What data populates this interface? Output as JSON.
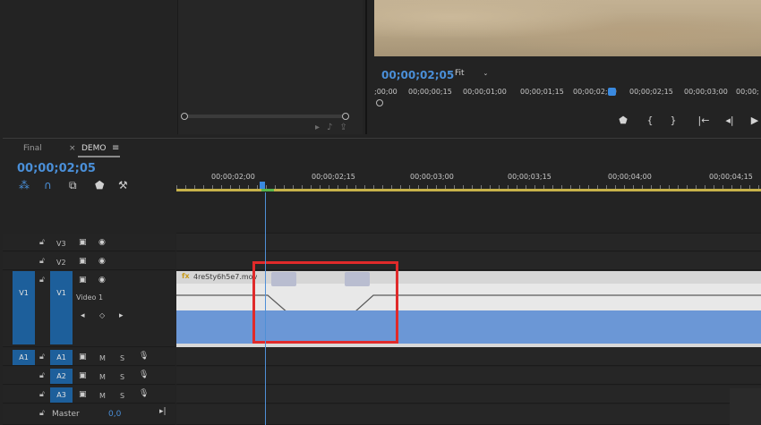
{
  "program_monitor": {
    "timecode": "00;00;02;05",
    "fit_label": "Fit",
    "ruler_ticks": [
      ";00;00",
      "00;00;00;15",
      "00;00;01;00",
      "00;00;01;15",
      "00;00;02;00",
      "00;00;02;15",
      "00;00;03;00",
      "00;00;"
    ],
    "buttons": [
      {
        "name": "add-marker-button",
        "icon": "marker-icon",
        "glyph": "⬟"
      },
      {
        "name": "mark-in-button",
        "icon": "mark-in-icon",
        "glyph": "{"
      },
      {
        "name": "mark-out-button",
        "icon": "mark-out-icon",
        "glyph": "}"
      },
      {
        "name": "go-to-in-button",
        "icon": "go-to-in-icon",
        "glyph": "|←"
      },
      {
        "name": "step-back-button",
        "icon": "step-back-icon",
        "glyph": "◂|"
      },
      {
        "name": "play-button",
        "icon": "play-icon",
        "glyph": "▶"
      }
    ]
  },
  "timeline": {
    "tabs": [
      {
        "label": "Final",
        "active": false
      },
      {
        "label": "DEMO",
        "active": true
      }
    ],
    "tab_close": "×",
    "tab_menu": "≡",
    "timecode": "00;00;02;05",
    "ruler_ticks": [
      "00;00;02;00",
      "00;00;02;15",
      "00;00;03;00",
      "00;00;03;15",
      "00;00;04;00",
      "00;00;04;15"
    ],
    "tracks": {
      "v3": {
        "label": "V3"
      },
      "v2": {
        "label": "V2"
      },
      "v1": {
        "label": "V1",
        "source": "V1",
        "name": "Video 1"
      },
      "a1": {
        "label": "A1",
        "source": "A1",
        "m": "M",
        "s": "S"
      },
      "a2": {
        "label": "A2",
        "m": "M",
        "s": "S"
      },
      "a3": {
        "label": "A3",
        "m": "M",
        "s": "S"
      },
      "master": {
        "label": "Master",
        "value": "0,0"
      }
    },
    "clip": {
      "fx": "fx",
      "name": "4reSty6h5e7.mov"
    }
  },
  "colors": {
    "accent_blue": "#4a8fd8",
    "highlight_red": "#e02a2a",
    "clip_blue": "#6b97d6"
  }
}
